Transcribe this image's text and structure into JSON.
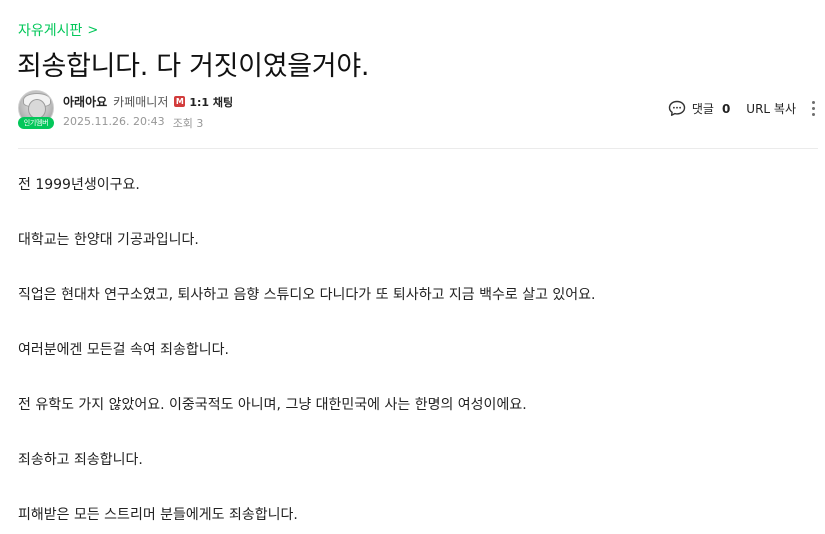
{
  "breadcrumb": {
    "label": "자유게시판",
    "chevron": ">"
  },
  "post": {
    "title": "죄송합니다. 다 거짓이였을거야."
  },
  "author": {
    "name": "아래아요",
    "role": "카페매니저",
    "manager_badge": "M",
    "chat_label": "1:1 채팅",
    "member_badge": "인기멤버",
    "date": "2025.11.26. 20:43",
    "views": "조회 3"
  },
  "tools": {
    "comment_label": "댓글",
    "comment_count": "0",
    "url_copy": "URL 복사"
  },
  "content": {
    "paragraphs": [
      "전 1999년생이구요.",
      "대학교는 한양대 기공과입니다.",
      "직업은 현대차 연구소였고, 퇴사하고 음향 스튜디오 다니다가 또 퇴사하고 지금 백수로 살고 있어요.",
      "여러분에겐 모든걸 속여 죄송합니다.",
      "전 유학도 가지 않았어요. 이중국적도 아니며, 그냥 대한민국에 사는 한명의 여성이에요.",
      "죄송하고 죄송합니다.",
      "피해받은 모든 스트리머 분들에게도 죄송합니다."
    ]
  },
  "colors": {
    "accent": "#03c75a",
    "manager_badge": "#d23c3c",
    "meta_text": "#979797"
  },
  "icons": {
    "comment": "speech-bubble-icon",
    "more": "vertical-dots-icon"
  }
}
